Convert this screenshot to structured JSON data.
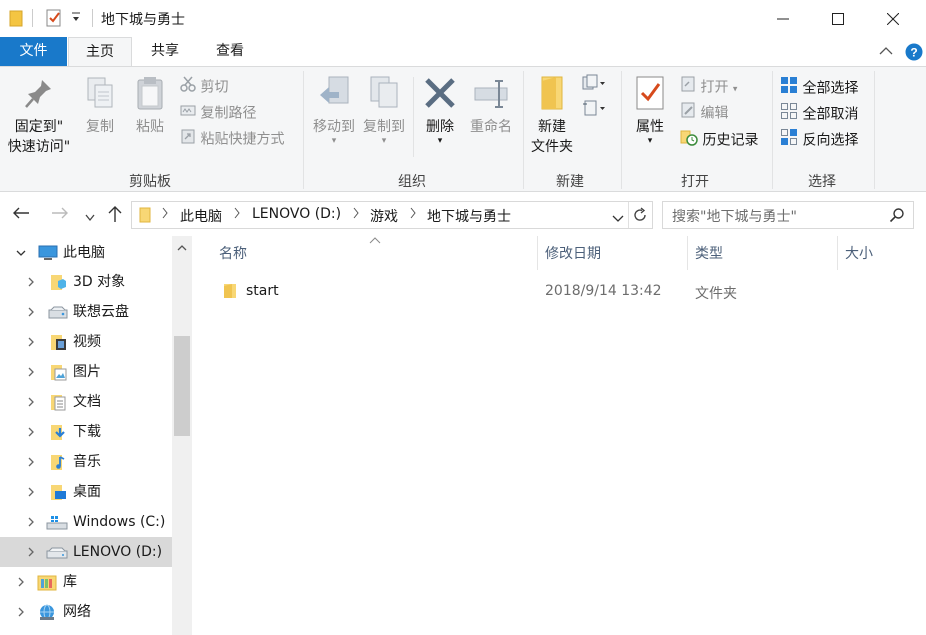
{
  "window": {
    "title": "地下城与勇士",
    "controls": {
      "minimize": "minimize-icon",
      "maximize": "maximize-icon",
      "close": "close-icon"
    }
  },
  "ribbon": {
    "tabs": [
      "文件",
      "主页",
      "共享",
      "查看"
    ],
    "clipboard": {
      "label": "剪贴板",
      "pin_line1": "固定到\"",
      "pin_line2": "快速访问\"",
      "copy": "复制",
      "paste": "粘贴",
      "cut": "剪切",
      "copy_path": "复制路径",
      "paste_shortcut": "粘贴快捷方式"
    },
    "organize": {
      "label": "组织",
      "move_to": "移动到",
      "copy_to": "复制到",
      "delete": "删除",
      "rename": "重命名"
    },
    "new": {
      "label": "新建",
      "new_folder_line1": "新建",
      "new_folder_line2": "文件夹"
    },
    "open": {
      "label": "打开",
      "properties": "属性",
      "open": "打开",
      "edit": "编辑",
      "history": "历史记录"
    },
    "select": {
      "label": "选择",
      "select_all": "全部选择",
      "select_none": "全部取消",
      "invert": "反向选择"
    }
  },
  "address": {
    "crumbs": [
      "此电脑",
      "LENOVO (D:)",
      "游戏",
      "地下城与勇士"
    ],
    "search_placeholder": "搜索\"地下城与勇士\""
  },
  "nav": {
    "items": [
      {
        "label": "此电脑",
        "expanded": true
      },
      {
        "label": "3D 对象"
      },
      {
        "label": "联想云盘"
      },
      {
        "label": "视频"
      },
      {
        "label": "图片"
      },
      {
        "label": "文档"
      },
      {
        "label": "下载"
      },
      {
        "label": "音乐"
      },
      {
        "label": "桌面"
      },
      {
        "label": "Windows (C:)"
      },
      {
        "label": "LENOVO (D:)",
        "selected": true
      },
      {
        "label": "库"
      },
      {
        "label": "网络"
      }
    ]
  },
  "content": {
    "columns": [
      "名称",
      "修改日期",
      "类型",
      "大小"
    ],
    "rows": [
      {
        "name": "start",
        "modified": "2018/9/14 13:42",
        "type": "文件夹",
        "size": ""
      }
    ]
  },
  "colors": {
    "accent": "#1979ca",
    "folder": "#f8d775",
    "selection": "#d9d9d9"
  }
}
